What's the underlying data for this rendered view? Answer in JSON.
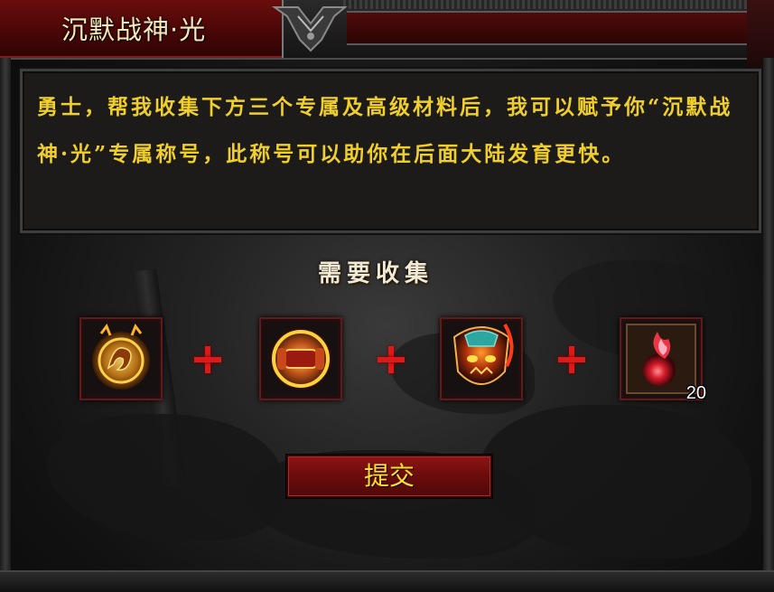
{
  "window": {
    "title": "沉默战神·光"
  },
  "description": {
    "text": "勇士，帮我收集下方三个专属及高级材料后，我可以赋予你“沉默战神·光”专属称号，此称号可以助你在后面大陆发育更快。"
  },
  "collect": {
    "heading": "需要收集",
    "items": [
      {
        "name": "golden-dragon-medallion",
        "count": ""
      },
      {
        "name": "fiery-scroll",
        "count": ""
      },
      {
        "name": "demon-mask-amulet",
        "count": ""
      },
      {
        "name": "red-flame-orb",
        "count": "20"
      }
    ]
  },
  "actions": {
    "submit_label": "提交"
  },
  "colors": {
    "desc_text": "#f0cf2a",
    "button_text": "#ffe033",
    "plus": "#e01818",
    "title_tab": "#4a0707"
  }
}
